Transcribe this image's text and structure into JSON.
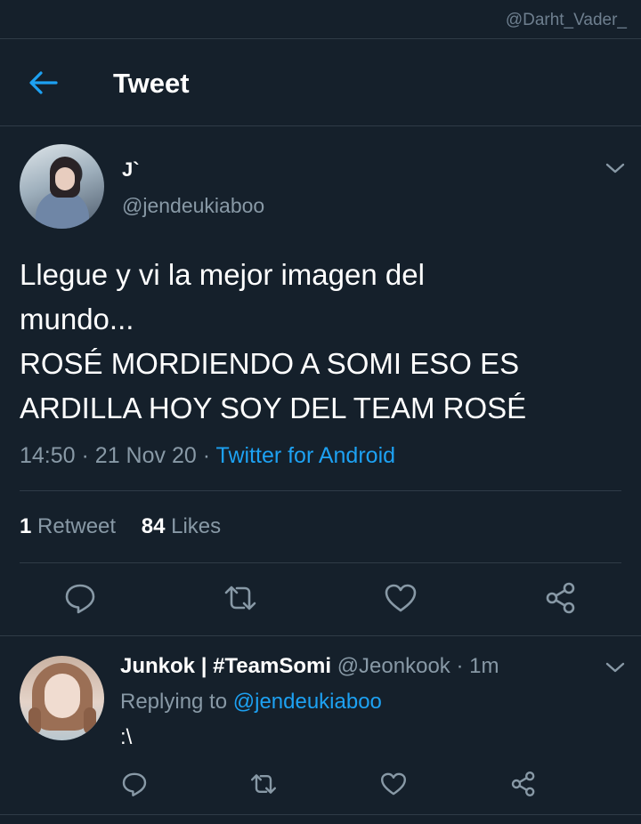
{
  "watermark": "@Darht_Vader_",
  "header": {
    "title": "Tweet"
  },
  "tweet": {
    "author_name": "J`",
    "author_handle": "@jendeukiaboo",
    "text": "Llegue y vi la mejor imagen del\nmundo...\nROSÉ MORDIENDO A SOMI ESO ES\nARDILLA HOY SOY DEL TEAM ROSÉ",
    "time": "14:50",
    "date": "21 Nov 20",
    "source": "Twitter for Android",
    "retweets_count": "1",
    "retweets_label": "Retweet",
    "likes_count": "84",
    "likes_label": "Likes"
  },
  "reply": {
    "author_name": "Junkok | #TeamSomi",
    "author_handle": "@Jeonkook",
    "time": "1m",
    "replying_prefix": "Replying to",
    "replying_to": "@jendeukiaboo",
    "text": ":\\"
  },
  "icons": {
    "back": "arrow-left-icon",
    "menu": "chevron-down-icon",
    "reply": "comment-icon",
    "retweet": "retweet-icon",
    "like": "heart-icon",
    "share": "share-icon"
  },
  "colors": {
    "background": "#15202b",
    "accent": "#1da1f2",
    "muted_text": "#8899a6",
    "divider": "#2f3b47"
  }
}
